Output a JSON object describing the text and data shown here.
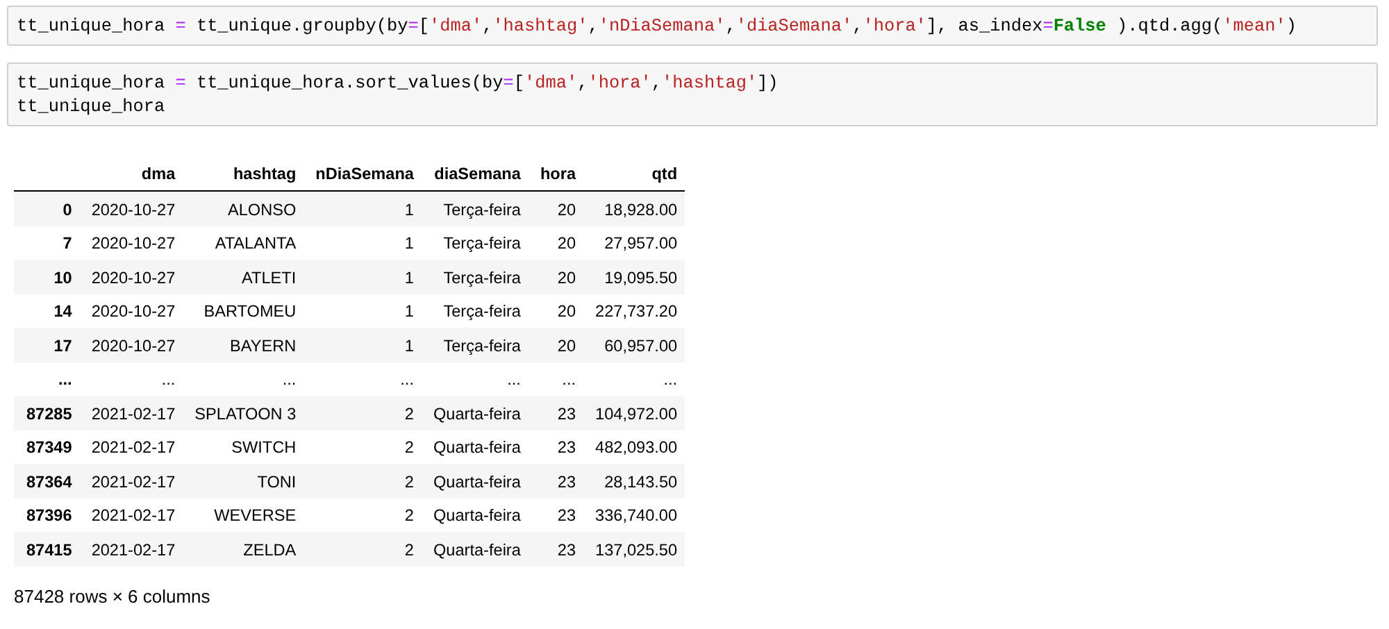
{
  "cells": [
    {
      "lines": [
        [
          {
            "text": "tt_unique_hora ",
            "kind": "plain"
          },
          {
            "text": "=",
            "kind": "op"
          },
          {
            "text": " tt_unique.groupby(by",
            "kind": "plain"
          },
          {
            "text": "=",
            "kind": "op"
          },
          {
            "text": "[",
            "kind": "plain"
          },
          {
            "text": "'dma'",
            "kind": "str"
          },
          {
            "text": ",",
            "kind": "plain"
          },
          {
            "text": "'hashtag'",
            "kind": "str"
          },
          {
            "text": ",",
            "kind": "plain"
          },
          {
            "text": "'nDiaSemana'",
            "kind": "str"
          },
          {
            "text": ",",
            "kind": "plain"
          },
          {
            "text": "'diaSemana'",
            "kind": "str"
          },
          {
            "text": ",",
            "kind": "plain"
          },
          {
            "text": "'hora'",
            "kind": "str"
          },
          {
            "text": "], as_index",
            "kind": "plain"
          },
          {
            "text": "=",
            "kind": "op"
          },
          {
            "text": "False",
            "kind": "kw"
          },
          {
            "text": " ).qtd.agg(",
            "kind": "plain"
          },
          {
            "text": "'mean'",
            "kind": "str"
          },
          {
            "text": ")",
            "kind": "plain"
          }
        ]
      ]
    },
    {
      "lines": [
        [
          {
            "text": "tt_unique_hora ",
            "kind": "plain"
          },
          {
            "text": "=",
            "kind": "op"
          },
          {
            "text": " tt_unique_hora.sort_values(by",
            "kind": "plain"
          },
          {
            "text": "=",
            "kind": "op"
          },
          {
            "text": "[",
            "kind": "plain"
          },
          {
            "text": "'dma'",
            "kind": "str"
          },
          {
            "text": ",",
            "kind": "plain"
          },
          {
            "text": "'hora'",
            "kind": "str"
          },
          {
            "text": ",",
            "kind": "plain"
          },
          {
            "text": "'hashtag'",
            "kind": "str"
          },
          {
            "text": "])",
            "kind": "plain"
          }
        ],
        [
          {
            "text": "tt_unique_hora",
            "kind": "plain"
          }
        ]
      ],
      "output": {
        "table": {
          "columns": [
            "dma",
            "hashtag",
            "nDiaSemana",
            "diaSemana",
            "hora",
            "qtd"
          ],
          "rows": [
            {
              "index": "0",
              "cells": [
                "2020-10-27",
                "ALONSO",
                "1",
                "Terça-feira",
                "20",
                "18,928.00"
              ]
            },
            {
              "index": "7",
              "cells": [
                "2020-10-27",
                "ATALANTA",
                "1",
                "Terça-feira",
                "20",
                "27,957.00"
              ]
            },
            {
              "index": "10",
              "cells": [
                "2020-10-27",
                "ATLETI",
                "1",
                "Terça-feira",
                "20",
                "19,095.50"
              ]
            },
            {
              "index": "14",
              "cells": [
                "2020-10-27",
                "BARTOMEU",
                "1",
                "Terça-feira",
                "20",
                "227,737.20"
              ]
            },
            {
              "index": "17",
              "cells": [
                "2020-10-27",
                "BAYERN",
                "1",
                "Terça-feira",
                "20",
                "60,957.00"
              ]
            },
            {
              "index": "...",
              "cells": [
                "...",
                "...",
                "...",
                "...",
                "...",
                "..."
              ]
            },
            {
              "index": "87285",
              "cells": [
                "2021-02-17",
                "SPLATOON 3",
                "2",
                "Quarta-feira",
                "23",
                "104,972.00"
              ]
            },
            {
              "index": "87349",
              "cells": [
                "2021-02-17",
                "SWITCH",
                "2",
                "Quarta-feira",
                "23",
                "482,093.00"
              ]
            },
            {
              "index": "87364",
              "cells": [
                "2021-02-17",
                "TONI",
                "2",
                "Quarta-feira",
                "23",
                "28,143.50"
              ]
            },
            {
              "index": "87396",
              "cells": [
                "2021-02-17",
                "WEVERSE",
                "2",
                "Quarta-feira",
                "23",
                "336,740.00"
              ]
            },
            {
              "index": "87415",
              "cells": [
                "2021-02-17",
                "ZELDA",
                "2",
                "Quarta-feira",
                "23",
                "137,025.50"
              ]
            }
          ]
        },
        "summary": "87428 rows × 6 columns"
      }
    }
  ]
}
